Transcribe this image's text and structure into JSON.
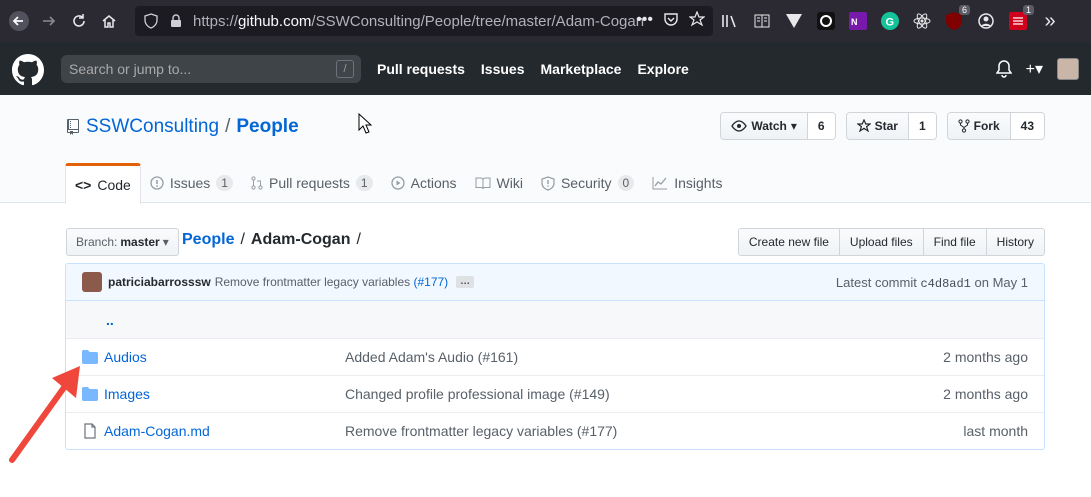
{
  "browser": {
    "url_protocol": "https://",
    "url_host": "github.com",
    "url_path": "/SSWConsulting/People/tree/master/Adam-Cogan",
    "url_actions": "•••",
    "ext_badge_1": "6",
    "ext_badge_2": "1",
    "overflow": "»"
  },
  "gh_header": {
    "search_placeholder": "Search or jump to...",
    "slash_hint": "/",
    "nav": [
      "Pull requests",
      "Issues",
      "Marketplace",
      "Explore"
    ],
    "plus": "+▾"
  },
  "repo": {
    "owner": "SSWConsulting",
    "sep": "/",
    "name": "People",
    "watch_label": "Watch",
    "watch_count": "6",
    "star_label": "Star",
    "star_count": "1",
    "fork_label": "Fork",
    "fork_count": "43"
  },
  "tabs": [
    {
      "label": "Code",
      "counter": ""
    },
    {
      "label": "Issues",
      "counter": "1"
    },
    {
      "label": "Pull requests",
      "counter": "1"
    },
    {
      "label": "Actions",
      "counter": ""
    },
    {
      "label": "Wiki",
      "counter": ""
    },
    {
      "label": "Security",
      "counter": "0"
    },
    {
      "label": "Insights",
      "counter": ""
    }
  ],
  "file_nav": {
    "branch_prefix": "Branch:",
    "branch": "master",
    "crumb_root": "People",
    "crumb_current": "Adam-Cogan",
    "sep": "/",
    "buttons": [
      "Create new file",
      "Upload files",
      "Find file",
      "History"
    ]
  },
  "commit": {
    "author": "patriciabarrosssw",
    "message": "Remove frontmatter legacy variables",
    "issue": "(#177)",
    "ellipsis": "…",
    "latest_label": "Latest commit",
    "sha": "c4d8ad1",
    "date": "on May 1"
  },
  "files": {
    "up": "..",
    "rows": [
      {
        "name": "Audios",
        "type": "folder",
        "message": "Added Adam's Audio (#161)",
        "age": "2 months ago"
      },
      {
        "name": "Images",
        "type": "folder",
        "message": "Changed profile professional image (#149)",
        "age": "2 months ago"
      },
      {
        "name": "Adam-Cogan.md",
        "type": "file",
        "message": "Remove frontmatter legacy variables (#177)",
        "age": "last month"
      }
    ]
  },
  "colors": {
    "link": "#0366d6",
    "header_bg": "#24292e",
    "tab_accent": "#e36209",
    "arrow": "#f0473c",
    "folder": "#79b8ff"
  }
}
